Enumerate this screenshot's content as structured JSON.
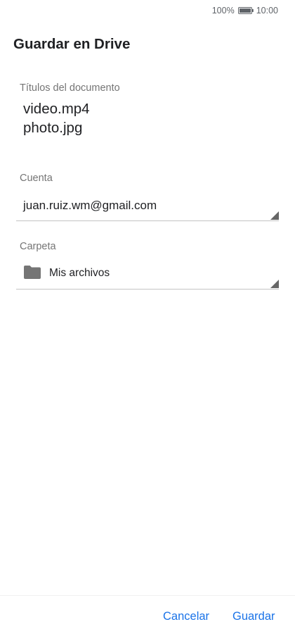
{
  "status_bar": {
    "battery_percent": "100%",
    "time": "10:00",
    "battery_level": 1.0
  },
  "title": "Guardar en Drive",
  "document_section": {
    "label": "Títulos del documento",
    "files": [
      "video.mp4",
      "photo.jpg"
    ]
  },
  "account_section": {
    "label": "Cuenta",
    "value": "juan.ruiz.wm@gmail.com"
  },
  "folder_section": {
    "label": "Carpeta",
    "value": "Mis archivos",
    "icon": "folder-icon"
  },
  "actions": {
    "cancel_label": "Cancelar",
    "save_label": "Guardar"
  },
  "colors": {
    "accent": "#1a73e8",
    "label_gray": "#757575",
    "icon_gray": "#757575",
    "text": "#202124"
  }
}
